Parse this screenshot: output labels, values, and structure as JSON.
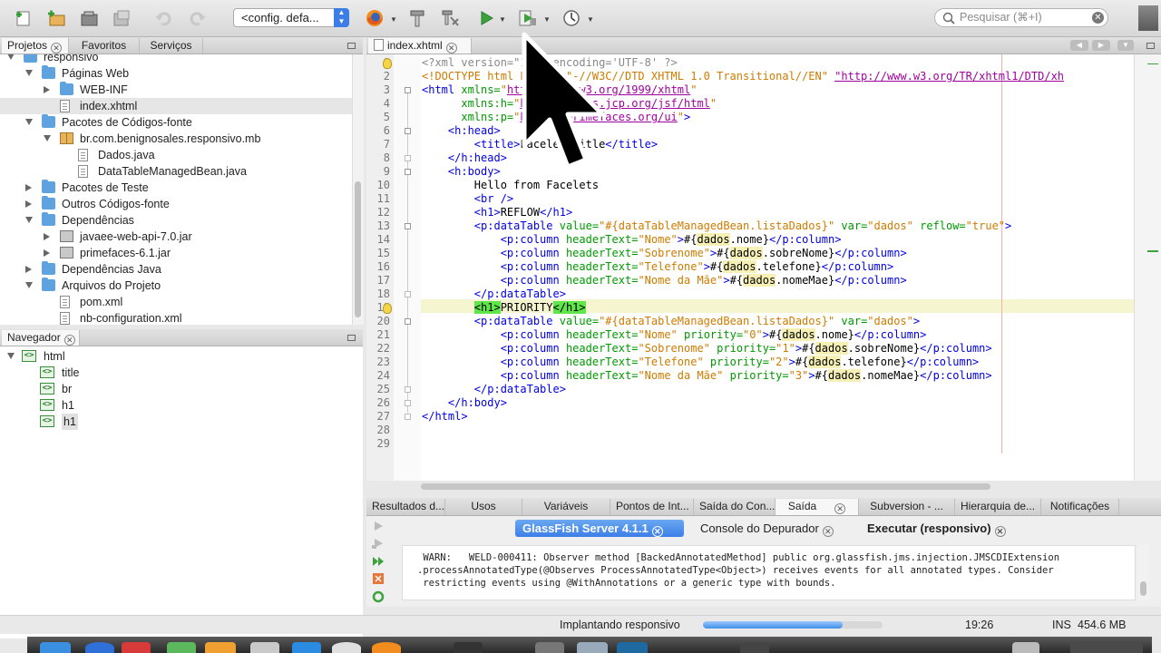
{
  "toolbar": {
    "config_label": "<config. defa...",
    "search_placeholder": "Pesquisar (⌘+I)"
  },
  "left_panel": {
    "tabs": [
      "Projetos",
      "Favoritos",
      "Serviços"
    ],
    "tree": [
      {
        "label": "responsivo",
        "level": 0,
        "icon": "project",
        "expand": "open"
      },
      {
        "label": "Páginas Web",
        "level": 1,
        "icon": "folder",
        "expand": "open"
      },
      {
        "label": "WEB-INF",
        "level": 2,
        "icon": "folder",
        "expand": "closed"
      },
      {
        "label": "index.xhtml",
        "level": 2,
        "icon": "file",
        "expand": "none",
        "selected": true
      },
      {
        "label": "Pacotes de Códigos-fonte",
        "level": 1,
        "icon": "folder",
        "expand": "open"
      },
      {
        "label": "br.com.benignosales.responsivo.mb",
        "level": 2,
        "icon": "package",
        "expand": "open"
      },
      {
        "label": "Dados.java",
        "level": 3,
        "icon": "file",
        "expand": "none"
      },
      {
        "label": "DataTableManagedBean.java",
        "level": 3,
        "icon": "file",
        "expand": "none"
      },
      {
        "label": "Pacotes de Teste",
        "level": 1,
        "icon": "folder",
        "expand": "closed"
      },
      {
        "label": "Outros Códigos-fonte",
        "level": 1,
        "icon": "folder",
        "expand": "closed"
      },
      {
        "label": "Dependências",
        "level": 1,
        "icon": "folder",
        "expand": "open"
      },
      {
        "label": "javaee-web-api-7.0.jar",
        "level": 2,
        "icon": "jar",
        "expand": "closed"
      },
      {
        "label": "primefaces-6.1.jar",
        "level": 2,
        "icon": "jar",
        "expand": "closed"
      },
      {
        "label": "Dependências Java",
        "level": 1,
        "icon": "folder",
        "expand": "closed"
      },
      {
        "label": "Arquivos do Projeto",
        "level": 1,
        "icon": "folder",
        "expand": "open"
      },
      {
        "label": "pom.xml",
        "level": 2,
        "icon": "file",
        "expand": "none"
      },
      {
        "label": "nb-configuration.xml",
        "level": 2,
        "icon": "file",
        "expand": "none"
      }
    ]
  },
  "navigator": {
    "title": "Navegador",
    "items": [
      {
        "label": "html",
        "level": 0,
        "selected": false
      },
      {
        "label": "title",
        "level": 1,
        "selected": false
      },
      {
        "label": "br",
        "level": 1,
        "selected": false
      },
      {
        "label": "h1",
        "level": 1,
        "selected": false
      },
      {
        "label": "h1",
        "level": 1,
        "selected": true
      }
    ]
  },
  "editor": {
    "tab_label": "index.xhtml",
    "lines": [
      [
        [
          "p",
          "<?xml version=\"1.0\" encoding='UTF-8' ?>"
        ]
      ],
      [
        [
          "v",
          "<!DOCTYPE html PUBLIC \"-//W3C//DTD XHTML 1.0 Transitional//EN\" "
        ],
        [
          "u",
          "\"http://www.w3.org/TR/xhtml1/DTD/xh"
        ]
      ],
      [
        [
          "t",
          "<html "
        ],
        [
          "a",
          "xmlns="
        ],
        [
          "v",
          "\""
        ],
        [
          "u",
          "http://www.w3.org/1999/xhtml"
        ],
        [
          "v",
          "\""
        ]
      ],
      [
        [
          "",
          "      "
        ],
        [
          "a",
          "xmlns:h="
        ],
        [
          "v",
          "\""
        ],
        [
          "u",
          "http://xmlns.jcp.org/jsf/html"
        ],
        [
          "v",
          "\""
        ]
      ],
      [
        [
          "",
          "      "
        ],
        [
          "a",
          "xmlns:p="
        ],
        [
          "v",
          "\""
        ],
        [
          "u",
          "http://primefaces.org/ui"
        ],
        [
          "v",
          "\""
        ],
        [
          "t",
          ">"
        ]
      ],
      [
        [
          "",
          "    "
        ],
        [
          "t",
          "<h:head>"
        ]
      ],
      [
        [
          "",
          "        "
        ],
        [
          "t",
          "<title>"
        ],
        [
          "",
          "Facelet Title"
        ],
        [
          "t",
          "</title>"
        ]
      ],
      [
        [
          "",
          "    "
        ],
        [
          "t",
          "</h:head>"
        ]
      ],
      [
        [
          "",
          "    "
        ],
        [
          "t",
          "<h:body>"
        ]
      ],
      [
        [
          "",
          "        Hello from Facelets"
        ]
      ],
      [
        [
          "",
          "        "
        ],
        [
          "t",
          "<br />"
        ]
      ],
      [
        [
          "",
          "        "
        ],
        [
          "t",
          "<h1>"
        ],
        [
          "",
          "REFLOW"
        ],
        [
          "t",
          "</h1>"
        ]
      ],
      [
        [
          "",
          "        "
        ],
        [
          "t",
          "<p:dataTable "
        ],
        [
          "a",
          "value="
        ],
        [
          "v",
          "\"#{dataTableManagedBean.listaDados}\""
        ],
        [
          "a",
          " var="
        ],
        [
          "v",
          "\"dados\""
        ],
        [
          "a",
          " reflow="
        ],
        [
          "v",
          "\"true\""
        ],
        [
          "t",
          ">"
        ]
      ],
      [
        [
          "",
          "            "
        ],
        [
          "t",
          "<p:column "
        ],
        [
          "a",
          "headerText="
        ],
        [
          "v",
          "\"Nome\""
        ],
        [
          "t",
          ">"
        ],
        [
          "",
          "#{"
        ],
        [
          "hl",
          "dados"
        ],
        [
          "",
          ".nome}"
        ],
        [
          "t",
          "</p:column>"
        ]
      ],
      [
        [
          "",
          "            "
        ],
        [
          "t",
          "<p:column "
        ],
        [
          "a",
          "headerText="
        ],
        [
          "v",
          "\"Sobrenome\""
        ],
        [
          "t",
          ">"
        ],
        [
          "",
          "#{"
        ],
        [
          "hl",
          "dados"
        ],
        [
          "",
          ".sobreNome}"
        ],
        [
          "t",
          "</p:column>"
        ]
      ],
      [
        [
          "",
          "            "
        ],
        [
          "t",
          "<p:column "
        ],
        [
          "a",
          "headerText="
        ],
        [
          "v",
          "\"Telefone\""
        ],
        [
          "t",
          ">"
        ],
        [
          "",
          "#{"
        ],
        [
          "hl",
          "dados"
        ],
        [
          "",
          ".telefone}"
        ],
        [
          "t",
          "</p:column>"
        ]
      ],
      [
        [
          "",
          "            "
        ],
        [
          "t",
          "<p:column "
        ],
        [
          "a",
          "headerText="
        ],
        [
          "v",
          "\"Nome da Mãe\""
        ],
        [
          "t",
          ">"
        ],
        [
          "",
          "#{"
        ],
        [
          "hl",
          "dados"
        ],
        [
          "",
          ".nomeMae}"
        ],
        [
          "t",
          "</p:column>"
        ]
      ],
      [
        [
          "",
          "        "
        ],
        [
          "t",
          "</p:dataTable>"
        ]
      ],
      [
        [
          "",
          "        "
        ],
        [
          "sel",
          "<h1>"
        ],
        [
          "",
          "PRIORITY"
        ],
        [
          "sel",
          "</h1>"
        ]
      ],
      [
        [
          "",
          "        "
        ],
        [
          "t",
          "<p:dataTable "
        ],
        [
          "a",
          "value="
        ],
        [
          "v",
          "\"#{dataTableManagedBean.listaDados}\""
        ],
        [
          "a",
          " var="
        ],
        [
          "v",
          "\"dados\""
        ],
        [
          "t",
          ">"
        ]
      ],
      [
        [
          "",
          "            "
        ],
        [
          "t",
          "<p:column "
        ],
        [
          "a",
          "headerText="
        ],
        [
          "v",
          "\"Nome\""
        ],
        [
          "a",
          " priority="
        ],
        [
          "v",
          "\"0\""
        ],
        [
          "t",
          ">"
        ],
        [
          "",
          "#{"
        ],
        [
          "hl",
          "dados"
        ],
        [
          "",
          ".nome}"
        ],
        [
          "t",
          "</p:column>"
        ]
      ],
      [
        [
          "",
          "            "
        ],
        [
          "t",
          "<p:column "
        ],
        [
          "a",
          "headerText="
        ],
        [
          "v",
          "\"Sobrenome\""
        ],
        [
          "a",
          " priority="
        ],
        [
          "v",
          "\"1\""
        ],
        [
          "t",
          ">"
        ],
        [
          "",
          "#{"
        ],
        [
          "hl",
          "dados"
        ],
        [
          "",
          ".sobreNome}"
        ],
        [
          "t",
          "</p:column>"
        ]
      ],
      [
        [
          "",
          "            "
        ],
        [
          "t",
          "<p:column "
        ],
        [
          "a",
          "headerText="
        ],
        [
          "v",
          "\"Telefone\""
        ],
        [
          "a",
          " priority="
        ],
        [
          "v",
          "\"2\""
        ],
        [
          "t",
          ">"
        ],
        [
          "",
          "#{"
        ],
        [
          "hl",
          "dados"
        ],
        [
          "",
          ".telefone}"
        ],
        [
          "t",
          "</p:column>"
        ]
      ],
      [
        [
          "",
          "            "
        ],
        [
          "t",
          "<p:column "
        ],
        [
          "a",
          "headerText="
        ],
        [
          "v",
          "\"Nome da Mãe\""
        ],
        [
          "a",
          " priority="
        ],
        [
          "v",
          "\"3\""
        ],
        [
          "t",
          ">"
        ],
        [
          "",
          "#{"
        ],
        [
          "hl",
          "dados"
        ],
        [
          "",
          ".nomeMae}"
        ],
        [
          "t",
          "</p:column>"
        ]
      ],
      [
        [
          "",
          "        "
        ],
        [
          "t",
          "</p:dataTable>"
        ]
      ],
      [
        [
          "",
          "    "
        ],
        [
          "t",
          "</h:body>"
        ]
      ],
      [
        [
          "t",
          "</html>"
        ]
      ],
      [
        [
          "",
          ""
        ]
      ],
      [
        [
          "",
          ""
        ]
      ]
    ]
  },
  "bottom_panel": {
    "tabs": [
      "Resultados d...",
      "Usos",
      "Variáveis",
      "Pontos de Int...",
      "Saída do Con...",
      "Saída",
      "Subversion - ...",
      "Hierarquia de...",
      "Notificações"
    ],
    "subtabs": [
      "GlassFish Server 4.1.1",
      "Console do Depurador",
      "Executar (responsivo)"
    ],
    "output_lines": [
      " WARN:   WELD-000411: Observer method [BackedAnnotatedMethod] public org.glassfish.jms.injection.JMSCDIExtension",
      ".processAnnotatedType(@Observes ProcessAnnotatedType<Object>) receives events for all annotated types. Consider",
      " restricting events using @WithAnnotations or a generic type with bounds."
    ]
  },
  "status": {
    "deploy_text": "Implantando responsivo",
    "progress": 0.78,
    "position": "19:26",
    "mode": "INS",
    "memory": "454.6 MB"
  },
  "colors": {
    "tag": "#0000e6",
    "attribute": "#009900",
    "value": "#ce7b00",
    "selection": "#5ee64b",
    "accent": "#3c7ee8"
  }
}
